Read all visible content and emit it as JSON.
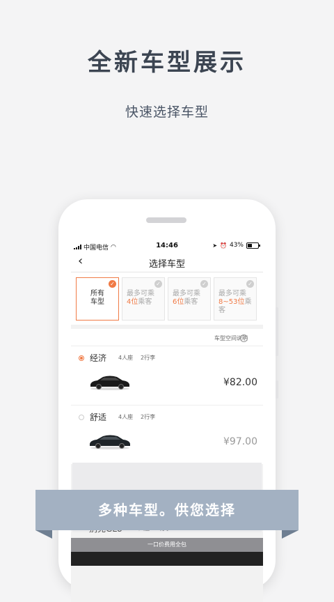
{
  "promo": {
    "headline": "全新车型展示",
    "subhead": "快速选择车型",
    "ribbon": "多种车型。供您选择"
  },
  "status_bar": {
    "carrier": "中国电信",
    "time": "14:46",
    "battery": "43%"
  },
  "nav": {
    "title": "选择车型",
    "back_icon": "chevron-left-icon"
  },
  "filters": [
    {
      "line1": "所有",
      "line2": "车型",
      "highlight": "",
      "suffix": "",
      "active": true
    },
    {
      "line1": "最多可乘",
      "line2": "",
      "highlight": "4位",
      "suffix": "乘客",
      "active": false
    },
    {
      "line1": "最多可乘",
      "line2": "",
      "highlight": "6位",
      "suffix": "乘客",
      "active": false
    },
    {
      "line1": "最多可乘",
      "line2": "",
      "highlight": "8~53位",
      "suffix": "乘客",
      "active": false
    }
  ],
  "info_link": "车型空间说明",
  "car_types": [
    {
      "name": "经济",
      "seats": "4人座",
      "luggage": "2行李",
      "price": "¥82.00",
      "selected": true
    },
    {
      "name": "舒适",
      "seats": "4人座",
      "luggage": "2行李",
      "price": "¥97.00",
      "selected": false
    },
    {
      "name": "别克GL8",
      "seats": "6人座",
      "luggage": "4行李",
      "price": "",
      "selected": false
    }
  ],
  "bottom_bar": "一口价费用全包",
  "colors": {
    "accent": "#f07a45",
    "ribbon": "#a3b1c2",
    "headline": "#3c4552"
  }
}
